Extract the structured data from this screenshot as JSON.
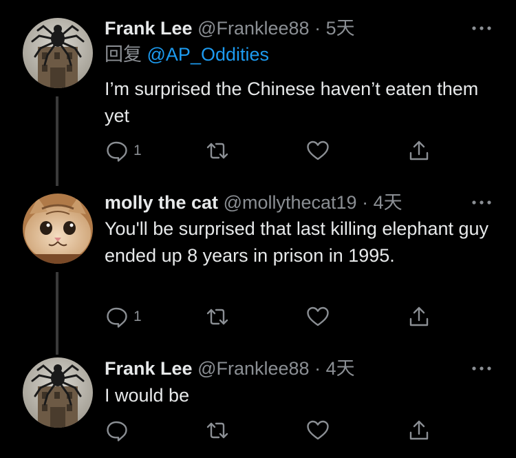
{
  "tweets": [
    {
      "name": "Frank Lee",
      "handle": "@Franklee88",
      "dot": "·",
      "time": "5天",
      "reply_label": "回复",
      "reply_mention": "@AP_Oddities",
      "text": "I’m surprised the Chinese haven’t eaten them yet",
      "reply_count": "1",
      "avatar": "spider-building-avatar"
    },
    {
      "name": "molly the cat",
      "handle": "@mollythecat19",
      "dot": "·",
      "time": "4天",
      "text": "You'll be surprised that last killing elephant guy ended up 8 years in prison in 1995.",
      "reply_count": "1",
      "avatar": "cat-avatar"
    },
    {
      "name": "Frank Lee",
      "handle": "@Franklee88",
      "dot": "·",
      "time": "4天",
      "text": "I would be",
      "reply_count": "",
      "avatar": "spider-building-avatar"
    }
  ],
  "icons": [
    "reply-icon",
    "retweet-icon",
    "like-icon",
    "share-icon",
    "more-icon"
  ],
  "colors": {
    "background": "#000000",
    "text": "#e7e9ea",
    "secondary": "#8b8f94",
    "link": "#1d9bf0"
  }
}
